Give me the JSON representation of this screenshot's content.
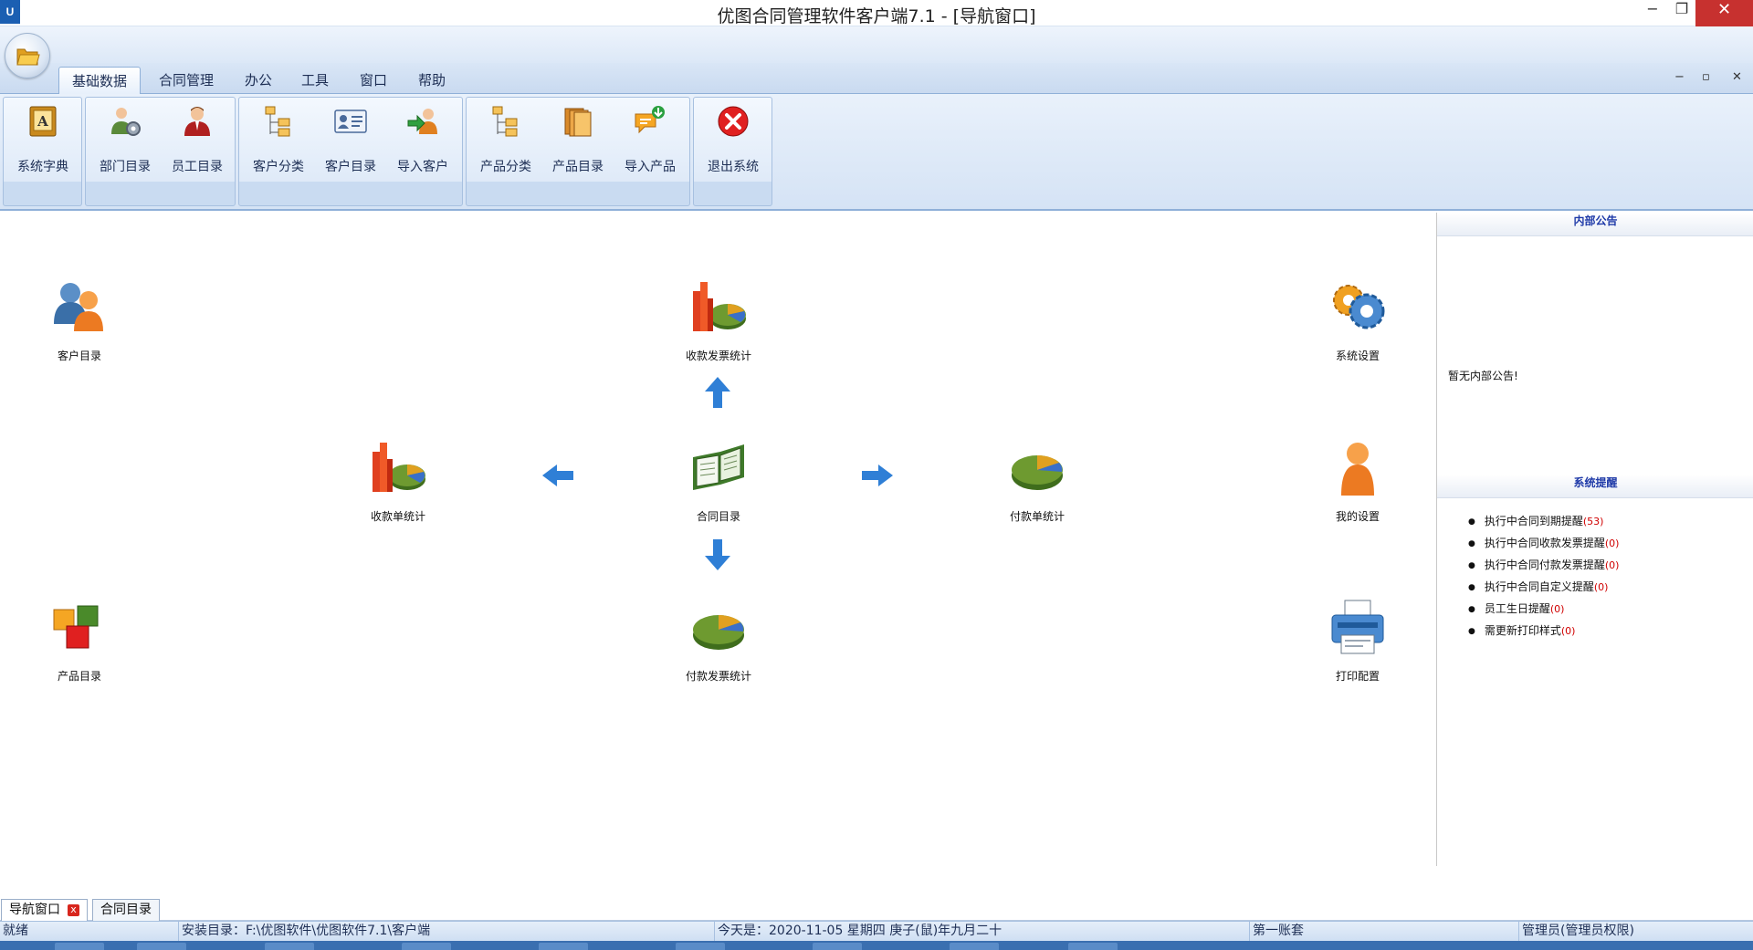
{
  "window": {
    "app_icon_text": "U",
    "title": "优图合同管理软件客户端7.1 - [导航窗口]",
    "min_symbol": "−",
    "max_symbol": "❐",
    "close_symbol": "✕"
  },
  "ribbon_tabs": [
    "基础数据",
    "合同管理",
    "办公",
    "工具",
    "窗口",
    "帮助"
  ],
  "mdi_controls": [
    "−",
    "▫",
    "✕"
  ],
  "ribbon_buttons": [
    {
      "label": "系统字典",
      "icon": "dictionary-icon"
    },
    {
      "label": "部门目录",
      "icon": "department-icon"
    },
    {
      "label": "员工目录",
      "icon": "employee-icon"
    },
    {
      "label": "客户分类",
      "icon": "tree-icon"
    },
    {
      "label": "客户目录",
      "icon": "card-icon"
    },
    {
      "label": "导入客户",
      "icon": "import-user-icon"
    },
    {
      "label": "产品分类",
      "icon": "tree-icon"
    },
    {
      "label": "产品目录",
      "icon": "folders-icon"
    },
    {
      "label": "导入产品",
      "icon": "import-chat-icon"
    },
    {
      "label": "退出系统",
      "icon": "exit-icon"
    }
  ],
  "nav": {
    "customer_dir": "客户目录",
    "receipt_invoice_stats": "收款发票统计",
    "system_settings": "系统设置",
    "receipt_stats": "收款单统计",
    "contract_dir": "合同目录",
    "payment_stats": "付款单统计",
    "my_settings": "我的设置",
    "product_dir": "产品目录",
    "payment_invoice_stats": "付款发票统计",
    "print_config": "打印配置"
  },
  "panel": {
    "notice_title": "内部公告",
    "notice_text": "暂无内部公告!",
    "reminder_title": "系统提醒",
    "reminders": [
      {
        "label": "执行中合同到期提醒",
        "count": "(53)"
      },
      {
        "label": "执行中合同收款发票提醒",
        "count": "(0)"
      },
      {
        "label": "执行中合同付款发票提醒",
        "count": "(0)"
      },
      {
        "label": "执行中合同自定义提醒",
        "count": "(0)"
      },
      {
        "label": "员工生日提醒",
        "count": "(0)"
      },
      {
        "label": "需更新打印样式",
        "count": "(0)"
      }
    ]
  },
  "doc_tabs": [
    "导航窗口",
    "合同目录"
  ],
  "doc_tab_close": "x",
  "status": {
    "state": "就绪",
    "install_dir": "安装目录：F:\\优图软件\\优图软件7.1\\客户端",
    "today": "今天是：2020-11-05 星期四 庚子(鼠)年九月二十",
    "account": "第一账套",
    "user": "管理员(管理员权限)"
  }
}
